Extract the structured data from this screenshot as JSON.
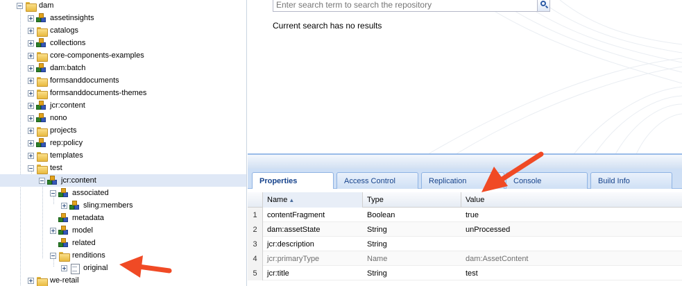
{
  "tree": {
    "items": [
      {
        "label": "dam",
        "icon": "folder-icon",
        "expander": "minus"
      },
      {
        "label": "assetinsights",
        "icon": "node-icon",
        "expander": "plus"
      },
      {
        "label": "catalogs",
        "icon": "folder-icon",
        "expander": "plus"
      },
      {
        "label": "collections",
        "icon": "node-icon",
        "expander": "plus"
      },
      {
        "label": "core-components-examples",
        "icon": "folder-icon",
        "expander": "plus"
      },
      {
        "label": "dam:batch",
        "icon": "node-icon",
        "expander": "plus"
      },
      {
        "label": "formsanddocuments",
        "icon": "folder-icon",
        "expander": "plus"
      },
      {
        "label": "formsanddocuments-themes",
        "icon": "folder-icon",
        "expander": "plus"
      },
      {
        "label": "jcr:content",
        "icon": "node-icon",
        "expander": "plus"
      },
      {
        "label": "nono",
        "icon": "node-icon",
        "expander": "plus"
      },
      {
        "label": "projects",
        "icon": "folder-icon",
        "expander": "plus"
      },
      {
        "label": "rep:policy",
        "icon": "node-icon",
        "expander": "plus"
      },
      {
        "label": "templates",
        "icon": "folder-icon",
        "expander": "plus"
      },
      {
        "label": "test",
        "icon": "folder-icon",
        "expander": "minus"
      },
      {
        "label": "jcr:content",
        "icon": "node-icon",
        "expander": "minus",
        "selected": true
      },
      {
        "label": "associated",
        "icon": "node-icon",
        "expander": "minus"
      },
      {
        "label": "sling:members",
        "icon": "node-icon",
        "expander": "plus"
      },
      {
        "label": "metadata",
        "icon": "node-icon",
        "expander": "none"
      },
      {
        "label": "model",
        "icon": "node-icon",
        "expander": "plus"
      },
      {
        "label": "related",
        "icon": "node-icon",
        "expander": "none"
      },
      {
        "label": "renditions",
        "icon": "folder-icon",
        "expander": "minus"
      },
      {
        "label": "original",
        "icon": "file-icon",
        "expander": "plus"
      },
      {
        "label": "we-retail",
        "icon": "folder-icon",
        "expander": "plus"
      }
    ]
  },
  "search": {
    "placeholder": "Enter search term to search the repository",
    "status": "Current search has no results"
  },
  "tabs": [
    {
      "label": "Properties",
      "active": true
    },
    {
      "label": "Access Control",
      "active": false
    },
    {
      "label": "Replication",
      "active": false
    },
    {
      "label": "Console",
      "active": false
    },
    {
      "label": "Build Info",
      "active": false
    }
  ],
  "grid": {
    "columns": [
      "Name",
      "Type",
      "Value"
    ],
    "sort_indicator": "▲",
    "rows": [
      {
        "num": "1",
        "name": "contentFragment",
        "type": "Boolean",
        "value": "true",
        "greyed": false
      },
      {
        "num": "2",
        "name": "dam:assetState",
        "type": "String",
        "value": "unProcessed",
        "greyed": false
      },
      {
        "num": "3",
        "name": "jcr:description",
        "type": "String",
        "value": "",
        "greyed": false
      },
      {
        "num": "4",
        "name": "jcr:primaryType",
        "type": "Name",
        "value": "dam:AssetContent",
        "greyed": true
      },
      {
        "num": "5",
        "name": "jcr:title",
        "type": "String",
        "value": "test",
        "greyed": false
      }
    ]
  },
  "colors": {
    "accent": "#15428b",
    "annotation_arrow": "#f04a25",
    "selection": "#dfe8f6"
  }
}
